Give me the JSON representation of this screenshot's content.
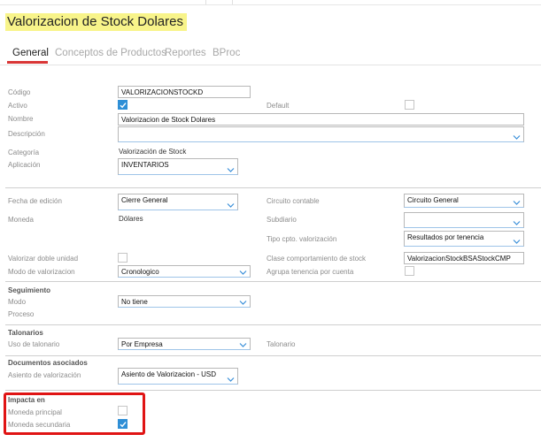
{
  "title": "Valorizacion de Stock Dolares",
  "tabs": [
    "General",
    "Conceptos de Productos",
    "Reportes",
    "BProc"
  ],
  "fields": {
    "codigo": {
      "label": "Código",
      "value": "VALORIZACIONSTOCKD"
    },
    "activo": {
      "label": "Activo",
      "checked": true
    },
    "default": {
      "label": "Default",
      "checked": false
    },
    "nombre": {
      "label": "Nombre",
      "value": "Valorizacion de Stock Dolares"
    },
    "descripcion": {
      "label": "Descripción",
      "value": ""
    },
    "categoria": {
      "label": "Categoría",
      "value": "Valorización de Stock"
    },
    "aplicacion": {
      "label": "Aplicación",
      "value": "INVENTARIOS"
    },
    "fecha_edicion": {
      "label": "Fecha de edición",
      "value": "Cierre General"
    },
    "circuito_contable": {
      "label": "Circuito contable",
      "value": "Circuito General"
    },
    "moneda": {
      "label": "Moneda",
      "value": "Dólares"
    },
    "subdiario": {
      "label": "Subdiario",
      "value": ""
    },
    "tipo_cpto": {
      "label": "Tipo cpto. valorización",
      "value": "Resultados por tenencia"
    },
    "valorizar_doble": {
      "label": "Valorizar doble unidad",
      "checked": false
    },
    "clase_comportamiento": {
      "label": "Clase comportamiento de stock",
      "value": "ValorizacionStockBSAStockCMP"
    },
    "modo_valorizacion": {
      "label": "Modo de valorizacion",
      "value": "Cronologico"
    },
    "agrupa_tenencia": {
      "label": "Agrupa tenencia por cuenta",
      "checked": false
    }
  },
  "seguimiento": {
    "title": "Seguimiento",
    "modo": {
      "label": "Modo",
      "value": "No tiene"
    },
    "proceso": {
      "label": "Proceso"
    }
  },
  "talonarios": {
    "title": "Talonarios",
    "uso": {
      "label": "Uso de talonario",
      "value": "Por Empresa"
    },
    "talonario": {
      "label": "Talonario"
    }
  },
  "documentos": {
    "title": "Documentos asociados",
    "asiento": {
      "label": "Asiento de valorización",
      "value": "Asiento de Valorizacion - USD"
    }
  },
  "impacta": {
    "title": "Impacta en",
    "moneda_principal": {
      "label": "Moneda principal",
      "checked": false
    },
    "moneda_secundaria": {
      "label": "Moneda secundaria",
      "checked": true
    }
  },
  "colors": {
    "accent": "#d93636",
    "checkbox": "#2f8fd6",
    "highlight": "#f8f48a",
    "callout": "#e01414"
  }
}
